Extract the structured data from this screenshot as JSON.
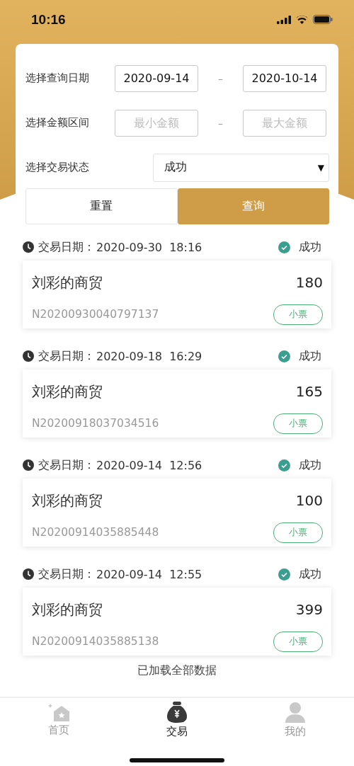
{
  "status_bar": {
    "time": "10:16"
  },
  "filter": {
    "date_label": "选择查询日期",
    "date_from": "2020-09-14",
    "date_to": "2020-10-14",
    "date_separator": "–",
    "amount_label": "选择金额区间",
    "amount_min": {
      "placeholder": "最小金额"
    },
    "amount_max": {
      "placeholder": "最大金额"
    },
    "amount_separator": "–",
    "status_label": "选择交易状态",
    "status_value": "成功",
    "dropdown_arrow": "▼",
    "buttons": [
      {
        "label": "重置",
        "kind": "secondary"
      },
      {
        "label": "查询",
        "kind": "primary"
      }
    ]
  },
  "transactions": [
    {
      "date_label": "交易日期：",
      "date": "2020-09-30",
      "time": "18:16",
      "status": {
        "text": "成功",
        "kind": "success"
      },
      "merchant": "刘彩的商贸",
      "amount": "180",
      "order_no": "N20200930040797137",
      "receipt": "小票"
    },
    {
      "date_label": "交易日期：",
      "date": "2020-09-18",
      "time": "16:29",
      "status": {
        "text": "成功",
        "kind": "success"
      },
      "merchant": "刘彩的商贸",
      "amount": "165",
      "order_no": "N20200918037034516",
      "receipt": "小票"
    },
    {
      "date_label": "交易日期：",
      "date": "2020-09-14",
      "time": "12:56",
      "status": {
        "text": "成功",
        "kind": "success"
      },
      "merchant": "刘彩的商贸",
      "amount": "100",
      "order_no": "N20200914035885448",
      "receipt": "小票"
    },
    {
      "date_label": "交易日期：",
      "date": "2020-09-14",
      "time": "12:55",
      "status": {
        "text": "成功",
        "kind": "success"
      },
      "merchant": "刘彩的商贸",
      "amount": "399",
      "order_no": "N20200914035885138",
      "receipt": "小票"
    }
  ],
  "footer_text": "已加载全部数据",
  "tabs": [
    {
      "label": "首页",
      "kind": "home",
      "selected": false
    },
    {
      "label": "交易",
      "kind": "trade",
      "selected": true
    },
    {
      "label": "我的",
      "kind": "profile",
      "selected": false
    }
  ]
}
